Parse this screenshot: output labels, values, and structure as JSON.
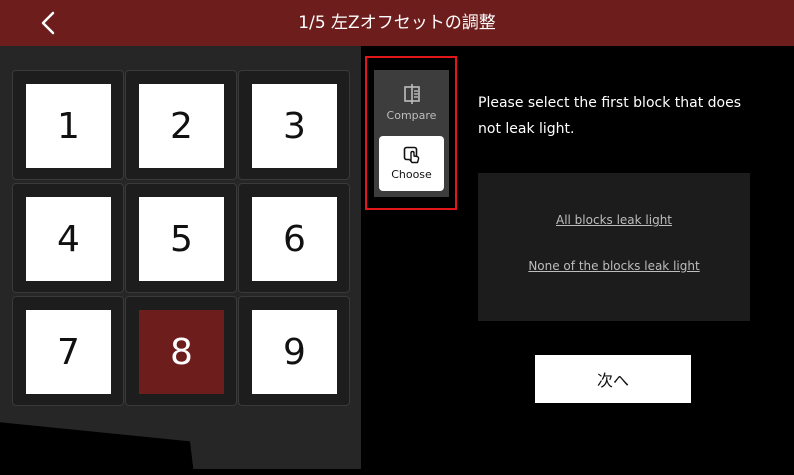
{
  "header": {
    "title": "1/5 左Zオフセットの調整",
    "back_icon": "chevron-left-icon"
  },
  "grid": {
    "blocks": [
      {
        "label": "1",
        "selected": false
      },
      {
        "label": "2",
        "selected": false
      },
      {
        "label": "3",
        "selected": false
      },
      {
        "label": "4",
        "selected": false
      },
      {
        "label": "5",
        "selected": false
      },
      {
        "label": "6",
        "selected": false
      },
      {
        "label": "7",
        "selected": false
      },
      {
        "label": "8",
        "selected": true
      },
      {
        "label": "9",
        "selected": false
      }
    ]
  },
  "mode": {
    "compare_label": "Compare",
    "choose_label": "Choose",
    "compare_icon": "compare-icon",
    "choose_icon": "tap-icon",
    "active": "Choose",
    "highlight_color": "#e0161b"
  },
  "instruction": "Please select the first block that does not leak light.",
  "options": {
    "all_leak": "All blocks leak light",
    "none_leak": "None of the blocks leak light"
  },
  "next_button": "次へ",
  "colors": {
    "accent": "#6e1d1d",
    "background": "#000000",
    "panel": "#262626"
  }
}
